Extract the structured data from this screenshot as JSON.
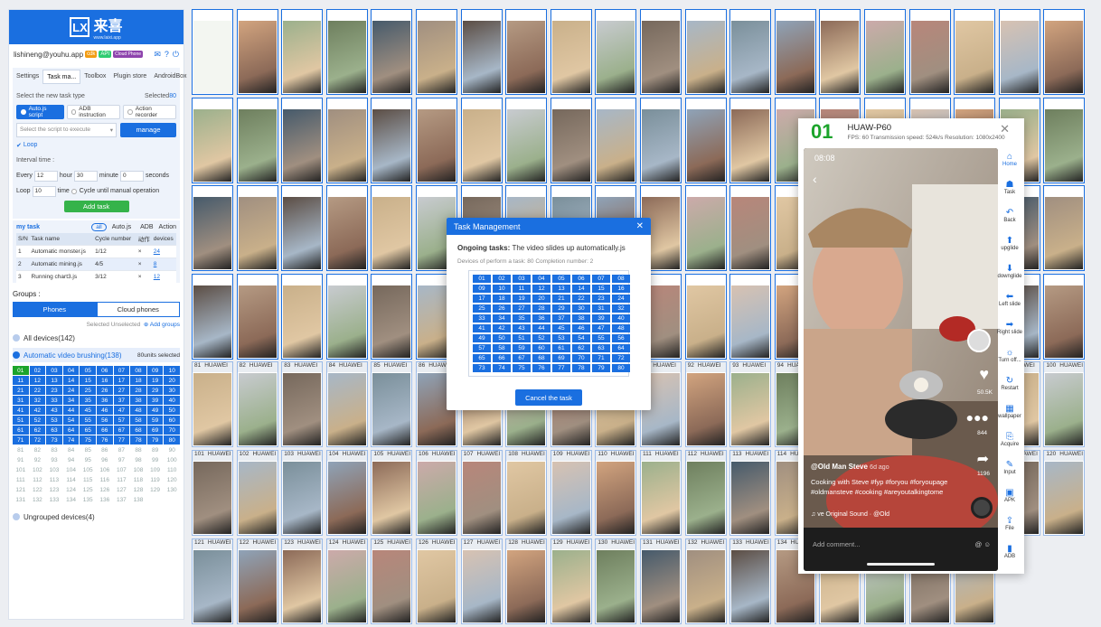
{
  "logo": {
    "mark": "LX",
    "name": "来喜",
    "sub": "www.laixi.app"
  },
  "account": {
    "email": "lishineng@youhu.app",
    "badge1": "cdk",
    "badge2": "API",
    "badge3": "Cloud Phone"
  },
  "tabs": [
    "Settings",
    "Task ma...",
    "Toolbox",
    "Plugin store",
    "AndroidBox"
  ],
  "task_type": {
    "label": "Select the new task type",
    "selected_label": "Selected",
    "selected_count": "80",
    "options": [
      "Auto.js script",
      "ADB instruction",
      "Action recorder"
    ]
  },
  "script_select": {
    "placeholder": "Select the script to execute",
    "manage": "manage"
  },
  "loop_label": "Loop",
  "interval": {
    "label": "Interval time :",
    "every": "Every",
    "hour_val": "12",
    "hour": "hour",
    "minute_val": "30",
    "minute": "minute",
    "second_val": "0",
    "seconds": "seconds",
    "loop": "Loop",
    "loop_val": "10",
    "time": "time",
    "cycle": "Cycle until manual operation"
  },
  "add_task": "Add task",
  "my_task": {
    "title": "my task",
    "filters": [
      "all",
      "Auto.js",
      "ADB",
      "Action"
    ],
    "headers": [
      "S/N",
      "Task name",
      "Cycle number",
      "动作",
      "devices"
    ],
    "rows": [
      {
        "sn": "1",
        "name": "Automatic monster.js",
        "cycle": "1/12",
        "act": "×",
        "dev": "24"
      },
      {
        "sn": "2",
        "name": "Automatic mining.js",
        "cycle": "4/5",
        "act": "×",
        "dev": "8"
      },
      {
        "sn": "3",
        "name": "Running chart3.js",
        "cycle": "3/12",
        "act": "×",
        "dev": "12"
      }
    ]
  },
  "groups": {
    "title": "Groups :",
    "tabs": [
      "Phones",
      "Cloud phones"
    ],
    "selected": "Selected",
    "unselected": "Unselected",
    "add": "Add groups",
    "all": "All devices(142)",
    "auto": "Automatic video brushing(138)",
    "auto_sel": "80units selected",
    "ungrouped": "Ungrouped devices(4)"
  },
  "grid_numbers": [
    "01",
    "02",
    "03",
    "04",
    "05",
    "06",
    "07",
    "08",
    "09",
    "10",
    "11",
    "12",
    "13",
    "14",
    "15",
    "16",
    "17",
    "18",
    "19",
    "20",
    "21",
    "22",
    "23",
    "24",
    "25",
    "26",
    "27",
    "28",
    "29",
    "30",
    "31",
    "32",
    "33",
    "34",
    "35",
    "36",
    "37",
    "38",
    "39",
    "40",
    "41",
    "42",
    "43",
    "44",
    "45",
    "46",
    "47",
    "48",
    "49",
    "50",
    "51",
    "52",
    "53",
    "54",
    "55",
    "56",
    "57",
    "58",
    "59",
    "60",
    "61",
    "62",
    "63",
    "64",
    "65",
    "66",
    "67",
    "68",
    "69",
    "70",
    "71",
    "72",
    "73",
    "74",
    "75",
    "76",
    "77",
    "78",
    "79",
    "80",
    "81",
    "82",
    "83",
    "84",
    "85",
    "86",
    "87",
    "88",
    "89",
    "90",
    "91",
    "92",
    "93",
    "94",
    "95",
    "96",
    "97",
    "98",
    "99",
    "100",
    "101",
    "102",
    "103",
    "104",
    "105",
    "106",
    "107",
    "108",
    "109",
    "110",
    "111",
    "112",
    "113",
    "114",
    "115",
    "116",
    "117",
    "118",
    "119",
    "120",
    "121",
    "122",
    "123",
    "124",
    "125",
    "126",
    "127",
    "128",
    "129",
    "130",
    "131",
    "132",
    "133",
    "134",
    "135",
    "136",
    "137",
    "138"
  ],
  "device_model": "HUAWEI",
  "modal": {
    "title": "Task Management",
    "ongoing_label": "Ongoing tasks:",
    "ongoing_value": "The video slides up automatically.js",
    "devices_text": "Devices of perform a task: 80      Completion number: 2",
    "cancel": "Cancel the task"
  },
  "viewer": {
    "num": "01",
    "model": "HUAW-P60",
    "stats": "FPS: 60  Transmission speed: 524k/s  Resolution: 1080x2400",
    "time": "08:08",
    "user": "@Old Man Steve",
    "ago": "6d ago",
    "caption": "Cooking with Steve #fyp #foryou #foryoupage #oldmansteve #cooking #areyoutalkingtome",
    "sound": "ve Original Sound  ·  @Old",
    "likes": "50.5K",
    "comments": "844",
    "shares": "1196",
    "comment_ph": "Add comment..."
  },
  "side_buttons": [
    "Home",
    "Task",
    "Back",
    "upglide",
    "downglide",
    "Left slide",
    "Right slide",
    "Turn off...",
    "Restart",
    "wallpaper",
    "Acquire",
    "Input",
    "APK",
    "File",
    "ADB"
  ]
}
